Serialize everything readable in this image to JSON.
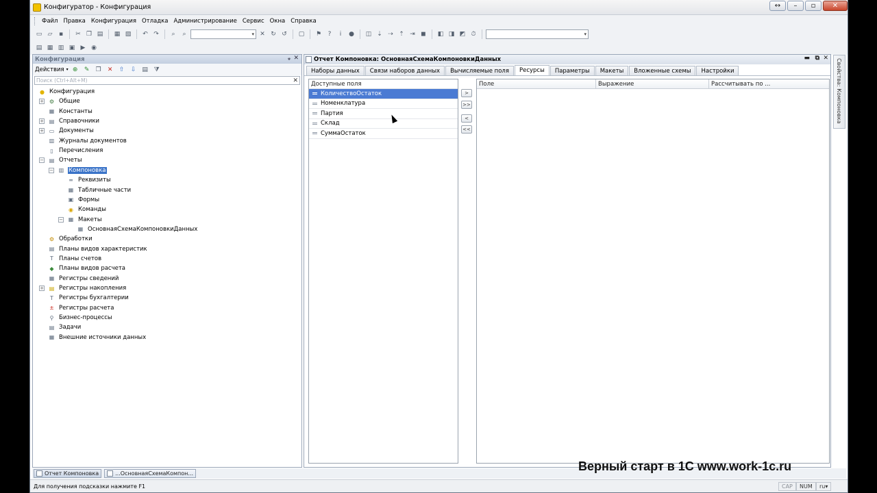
{
  "window": {
    "title": "Конфигуратор - Конфигурация"
  },
  "menu": [
    "Файл",
    "Правка",
    "Конфигурация",
    "Отладка",
    "Администрирование",
    "Сервис",
    "Окна",
    "Справка"
  ],
  "config_panel": {
    "title": "Конфигурация",
    "actions_label": "Действия",
    "search_placeholder": "Поиск (Ctrl+Alt+M)",
    "tree": [
      {
        "label": "Конфигурация",
        "level": 0,
        "icon": "config-icon",
        "expand": ""
      },
      {
        "label": "Общие",
        "level": 1,
        "icon": "common-icon",
        "expand": "+"
      },
      {
        "label": "Константы",
        "level": 1,
        "icon": "constants-icon",
        "expand": ""
      },
      {
        "label": "Справочники",
        "level": 1,
        "icon": "catalogs-icon",
        "expand": "+"
      },
      {
        "label": "Документы",
        "level": 1,
        "icon": "documents-icon",
        "expand": "+"
      },
      {
        "label": "Журналы документов",
        "level": 1,
        "icon": "journals-icon",
        "expand": ""
      },
      {
        "label": "Перечисления",
        "level": 1,
        "icon": "enums-icon",
        "expand": ""
      },
      {
        "label": "Отчеты",
        "level": 1,
        "icon": "reports-icon",
        "expand": "−"
      },
      {
        "label": "Компоновка",
        "level": 2,
        "icon": "report-icon",
        "expand": "−",
        "selected": true
      },
      {
        "label": "Реквизиты",
        "level": 3,
        "icon": "attributes-icon",
        "expand": ""
      },
      {
        "label": "Табличные части",
        "level": 3,
        "icon": "tabular-icon",
        "expand": ""
      },
      {
        "label": "Формы",
        "level": 3,
        "icon": "forms-icon",
        "expand": ""
      },
      {
        "label": "Команды",
        "level": 3,
        "icon": "commands-icon",
        "expand": ""
      },
      {
        "label": "Макеты",
        "level": 3,
        "icon": "templates-icon",
        "expand": "−"
      },
      {
        "label": "ОсновнаяСхемаКомпоновкиДанных",
        "level": 4,
        "icon": "schema-icon",
        "expand": ""
      },
      {
        "label": "Обработки",
        "level": 1,
        "icon": "dataprocessors-icon",
        "expand": ""
      },
      {
        "label": "Планы видов характеристик",
        "level": 1,
        "icon": "chart-char-icon",
        "expand": ""
      },
      {
        "label": "Планы счетов",
        "level": 1,
        "icon": "accounts-icon",
        "expand": ""
      },
      {
        "label": "Планы видов расчета",
        "level": 1,
        "icon": "calc-types-icon",
        "expand": ""
      },
      {
        "label": "Регистры сведений",
        "level": 1,
        "icon": "info-reg-icon",
        "expand": ""
      },
      {
        "label": "Регистры накопления",
        "level": 1,
        "icon": "accum-reg-icon",
        "expand": "+"
      },
      {
        "label": "Регистры бухгалтерии",
        "level": 1,
        "icon": "acc-reg-icon",
        "expand": ""
      },
      {
        "label": "Регистры расчета",
        "level": 1,
        "icon": "calc-reg-icon",
        "expand": ""
      },
      {
        "label": "Бизнес-процессы",
        "level": 1,
        "icon": "bp-icon",
        "expand": ""
      },
      {
        "label": "Задачи",
        "level": 1,
        "icon": "tasks-icon",
        "expand": ""
      },
      {
        "label": "Внешние источники данных",
        "level": 1,
        "icon": "ext-src-icon",
        "expand": ""
      }
    ]
  },
  "report_panel": {
    "title": "Отчет Компоновка: ОсновнаяСхемаКомпоновкиДанных",
    "tabs": [
      "Наборы данных",
      "Связи наборов данных",
      "Вычисляемые поля",
      "Ресурсы",
      "Параметры",
      "Макеты",
      "Вложенные схемы",
      "Настройки"
    ],
    "active_tab": "Ресурсы",
    "available_fields_header": "Доступные поля",
    "available_fields": [
      "КоличествоОстаток",
      "Номенклатура",
      "Партия",
      "Склад",
      "СуммаОстаток"
    ],
    "selected_field": "КоличествоОстаток",
    "arrow_buttons": [
      ">",
      ">>",
      "<",
      "<<"
    ],
    "resources_columns": [
      "Поле",
      "Выражение",
      "Рассчитывать по ..."
    ]
  },
  "side_tab": "Свойства: Компоновка",
  "taskbar": [
    "Отчет Компоновка",
    "...ОсновнаяСхемаКомпон..."
  ],
  "watermark": "Верный старт в 1С www.work-1c.ru",
  "status": {
    "hint": "Для получения подсказки нажмите F1",
    "cap": "CAP",
    "num": "NUM",
    "lang": "ru"
  }
}
